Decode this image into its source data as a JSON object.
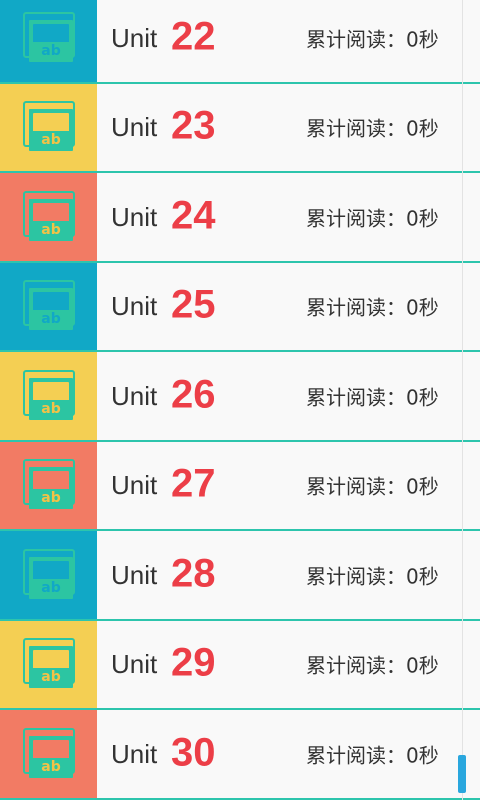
{
  "colors": {
    "divider": "#2dc5ad",
    "unit_number": "#ec3e47",
    "thumb_blue": "#11a8c6",
    "thumb_yellow": "#f4cf53",
    "thumb_coral": "#f27b64",
    "icon_green": "#2cc5a2",
    "icon_yellow_mark": "#f2c247",
    "scroll_indicator": "#2aa7de"
  },
  "units": [
    {
      "label": "Unit",
      "number": "22",
      "reading": "累计阅读：0秒",
      "thumb": "blue",
      "icon": "book-ab-icon"
    },
    {
      "label": "Unit",
      "number": "23",
      "reading": "累计阅读：0秒",
      "thumb": "yellow",
      "icon": "book-ab-icon"
    },
    {
      "label": "Unit",
      "number": "24",
      "reading": "累计阅读：0秒",
      "thumb": "coral",
      "icon": "book-ab-icon"
    },
    {
      "label": "Unit",
      "number": "25",
      "reading": "累计阅读：0秒",
      "thumb": "blue",
      "icon": "book-ab-icon"
    },
    {
      "label": "Unit",
      "number": "26",
      "reading": "累计阅读：0秒",
      "thumb": "yellow",
      "icon": "book-ab-icon"
    },
    {
      "label": "Unit",
      "number": "27",
      "reading": "累计阅读：0秒",
      "thumb": "coral",
      "icon": "book-ab-icon"
    },
    {
      "label": "Unit",
      "number": "28",
      "reading": "累计阅读：0秒",
      "thumb": "blue",
      "icon": "book-ab-icon"
    },
    {
      "label": "Unit",
      "number": "29",
      "reading": "累计阅读：0秒",
      "thumb": "yellow",
      "icon": "book-ab-icon"
    },
    {
      "label": "Unit",
      "number": "30",
      "reading": "累计阅读：0秒",
      "thumb": "coral",
      "icon": "book-ab-icon"
    }
  ]
}
